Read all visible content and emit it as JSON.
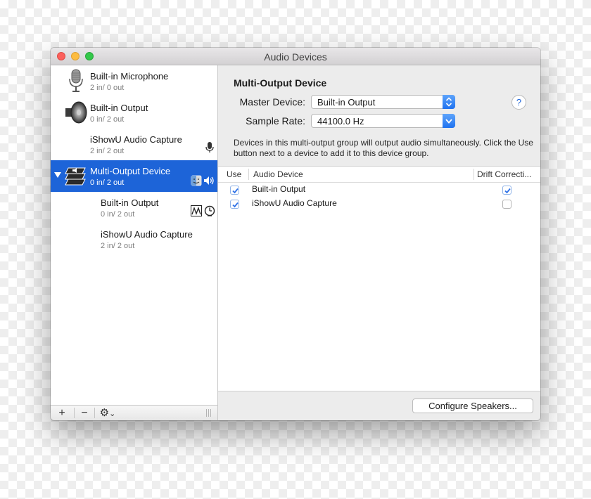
{
  "window": {
    "title": "Audio Devices"
  },
  "sidebar": {
    "devices": [
      {
        "name": "Built-in Microphone",
        "io": "2 in/ 0 out",
        "icon": "microphone-icon"
      },
      {
        "name": "Built-in Output",
        "io": "0 in/ 2 out",
        "icon": "speaker-icon"
      },
      {
        "name": "iShowU Audio Capture",
        "io": "2 in/ 2 out",
        "badge": "microphone-badge-icon"
      },
      {
        "name": "Multi-Output Device",
        "io": "0 in/ 2 out",
        "icon": "multi-output-icon",
        "selected": true,
        "expanded": true
      },
      {
        "name": "Built-in Output",
        "io": "0 in/ 2 out",
        "badges": [
          "waveform-icon",
          "clock-icon"
        ]
      },
      {
        "name": "iShowU Audio Capture",
        "io": "2 in/ 2 out"
      }
    ],
    "toolbar": {
      "add_label": "+",
      "remove_label": "−",
      "gear_label": "⚙",
      "gear_chevron": "⌄"
    }
  },
  "detail": {
    "title": "Multi-Output Device",
    "master_device": {
      "label": "Master Device:",
      "value": "Built-in Output"
    },
    "sample_rate": {
      "label": "Sample Rate:",
      "value": "44100.0 Hz"
    },
    "help_label": "?",
    "description": "Devices in this multi-output group will output audio simultaneously. Click the Use button next to a device to add it to this device group.",
    "table": {
      "columns": [
        "Use",
        "Audio Device",
        "Drift Correcti..."
      ],
      "rows": [
        {
          "use": true,
          "device": "Built-in Output",
          "drift": true
        },
        {
          "use": true,
          "device": "iShowU Audio Capture",
          "drift": false
        }
      ]
    },
    "configure_button": "Configure Speakers..."
  },
  "colors": {
    "selection": "#1d64d8",
    "accent": "#1f72f0"
  }
}
